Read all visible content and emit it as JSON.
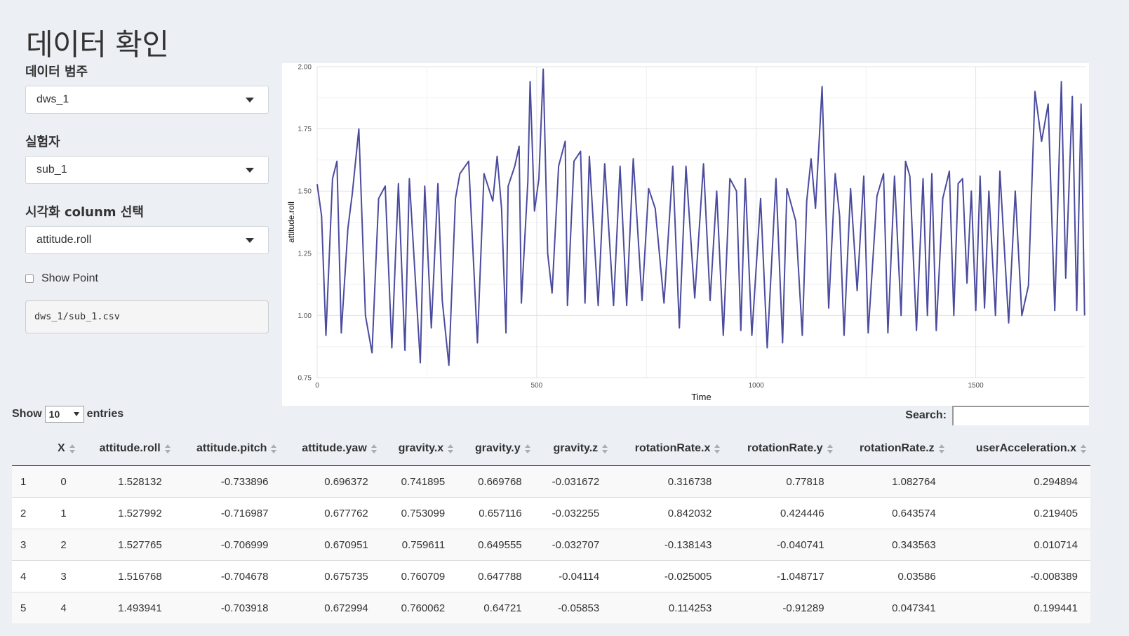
{
  "page": {
    "title": "데이터 확인"
  },
  "sidebar": {
    "category": {
      "label": "데이터 범주",
      "value": "dws_1"
    },
    "subject": {
      "label": "실험자",
      "value": "sub_1"
    },
    "column": {
      "label": "시각화 colunm 선택",
      "value": "attitude.roll"
    },
    "show_point": {
      "label": "Show Point",
      "checked": false
    },
    "file_path": "dws_1/sub_1.csv"
  },
  "chart_data": {
    "type": "line",
    "xlabel": "Time",
    "ylabel": "attitude.roll",
    "xlim": [
      0,
      1750
    ],
    "ylim": [
      0.75,
      2.0
    ],
    "x_ticks": [
      0,
      500,
      1000,
      1500
    ],
    "x_tick_labels": [
      "0",
      "500",
      "1000",
      "1500"
    ],
    "y_ticks": [
      0.75,
      1.0,
      1.25,
      1.5,
      1.75,
      2.0
    ],
    "y_tick_labels": [
      "0.75",
      "1.00",
      "1.25",
      "1.50",
      "1.75",
      "2.00"
    ],
    "grid": true,
    "line_color": "#4b4b9e",
    "series": [
      {
        "x": [
          0,
          10,
          20,
          35,
          45,
          55,
          70,
          80,
          95,
          110,
          125,
          140,
          155,
          170,
          185,
          200,
          210,
          220,
          235,
          245,
          260,
          275,
          285,
          300,
          315,
          325,
          345,
          365,
          380,
          400,
          410,
          420,
          430,
          435,
          450,
          460,
          465,
          480,
          485,
          495,
          505,
          515,
          525,
          535,
          550,
          565,
          570,
          585,
          600,
          610,
          620,
          640,
          655,
          675,
          690,
          705,
          720,
          740,
          755,
          770,
          790,
          810,
          825,
          840,
          860,
          880,
          895,
          910,
          925,
          940,
          955,
          965,
          975,
          990,
          1010,
          1025,
          1045,
          1060,
          1070,
          1090,
          1105,
          1115,
          1125,
          1135,
          1150,
          1165,
          1180,
          1190,
          1200,
          1215,
          1230,
          1245,
          1255,
          1275,
          1290,
          1300,
          1315,
          1330,
          1340,
          1350,
          1365,
          1380,
          1390,
          1400,
          1410,
          1425,
          1440,
          1450,
          1460,
          1470,
          1480,
          1490,
          1500,
          1510,
          1520,
          1530,
          1545,
          1555,
          1575,
          1590,
          1605,
          1620,
          1635,
          1650,
          1665,
          1680,
          1695,
          1705,
          1720,
          1730,
          1740,
          1748
        ],
        "y": [
          1.528,
          1.4,
          0.92,
          1.55,
          1.62,
          0.93,
          1.35,
          1.49,
          1.75,
          1.0,
          0.85,
          1.47,
          1.52,
          0.87,
          1.53,
          0.86,
          1.55,
          1.25,
          0.81,
          1.52,
          0.95,
          1.53,
          1.06,
          0.8,
          1.47,
          1.57,
          1.62,
          0.89,
          1.57,
          1.46,
          1.64,
          1.43,
          0.93,
          1.52,
          1.6,
          1.68,
          1.05,
          1.54,
          1.94,
          1.42,
          1.55,
          1.99,
          1.25,
          1.09,
          1.6,
          1.7,
          1.04,
          1.62,
          1.66,
          1.05,
          1.64,
          1.04,
          1.61,
          1.04,
          1.6,
          1.04,
          1.63,
          1.06,
          1.51,
          1.43,
          1.05,
          1.6,
          0.95,
          1.6,
          1.07,
          1.61,
          1.06,
          1.5,
          0.92,
          1.55,
          1.5,
          0.94,
          1.55,
          0.92,
          1.47,
          0.87,
          1.55,
          0.89,
          1.51,
          1.38,
          0.92,
          1.46,
          1.63,
          1.43,
          1.92,
          1.03,
          1.57,
          1.4,
          0.92,
          1.51,
          1.1,
          1.56,
          0.93,
          1.48,
          1.57,
          0.93,
          1.56,
          1.0,
          1.62,
          1.56,
          0.94,
          1.55,
          1.0,
          1.57,
          0.94,
          1.47,
          1.58,
          1.0,
          1.53,
          1.55,
          1.13,
          1.5,
          1.02,
          1.56,
          1.03,
          1.5,
          1.0,
          1.58,
          0.97,
          1.5,
          1.0,
          1.12,
          1.9,
          1.7,
          1.85,
          1.02,
          1.94,
          1.15,
          1.88,
          1.02,
          1.85,
          1.0
        ]
      }
    ]
  },
  "table": {
    "show_label": "Show",
    "entries_value": "10",
    "entries_label": "entries",
    "search_label": "Search:",
    "columns": [
      "",
      "X",
      "attitude.roll",
      "attitude.pitch",
      "attitude.yaw",
      "gravity.x",
      "gravity.y",
      "gravity.z",
      "rotationRate.x",
      "rotationRate.y",
      "rotationRate.z",
      "userAcceleration.x"
    ],
    "rows": [
      [
        "1",
        "0",
        "1.528132",
        "-0.733896",
        "0.696372",
        "0.741895",
        "0.669768",
        "-0.031672",
        "0.316738",
        "0.77818",
        "1.082764",
        "0.294894"
      ],
      [
        "2",
        "1",
        "1.527992",
        "-0.716987",
        "0.677762",
        "0.753099",
        "0.657116",
        "-0.032255",
        "0.842032",
        "0.424446",
        "0.643574",
        "0.219405"
      ],
      [
        "3",
        "2",
        "1.527765",
        "-0.706999",
        "0.670951",
        "0.759611",
        "0.649555",
        "-0.032707",
        "-0.138143",
        "-0.040741",
        "0.343563",
        "0.010714"
      ],
      [
        "4",
        "3",
        "1.516768",
        "-0.704678",
        "0.675735",
        "0.760709",
        "0.647788",
        "-0.04114",
        "-0.025005",
        "-1.048717",
        "0.03586",
        "-0.008389"
      ],
      [
        "5",
        "4",
        "1.493941",
        "-0.703918",
        "0.672994",
        "0.760062",
        "0.64721",
        "-0.05853",
        "0.114253",
        "-0.91289",
        "0.047341",
        "0.199441"
      ]
    ]
  }
}
